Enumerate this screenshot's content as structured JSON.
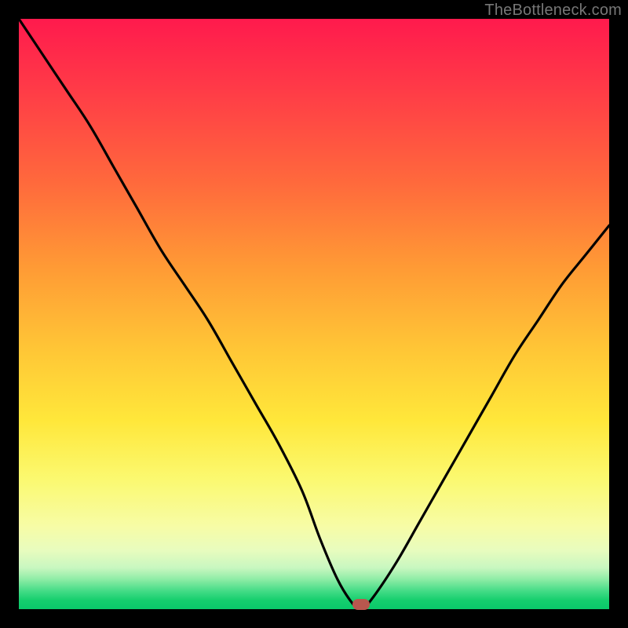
{
  "attribution": "TheBottleneck.com",
  "chart_data": {
    "type": "line",
    "title": "",
    "xlabel": "",
    "ylabel": "",
    "xlim": [
      0,
      100
    ],
    "ylim": [
      0,
      100
    ],
    "series": [
      {
        "name": "bottleneck-curve",
        "x": [
          0,
          4,
          8,
          12,
          16,
          20,
          24,
          28,
          32,
          36,
          40,
          44,
          48,
          51,
          54,
          56.5,
          58,
          60,
          64,
          68,
          72,
          76,
          80,
          84,
          88,
          92,
          96,
          100
        ],
        "y": [
          100,
          94,
          88,
          82,
          75,
          68,
          61,
          55,
          49,
          42,
          35,
          28,
          20,
          12,
          5,
          1,
          0,
          2,
          8,
          15,
          22,
          29,
          36,
          43,
          49,
          55,
          60,
          65
        ]
      }
    ],
    "marker": {
      "x": 58,
      "y": 0.8,
      "label": "optimal-point"
    },
    "colors": {
      "curve": "#000000",
      "marker": "#b9574e",
      "gradient_top": "#ff1a4d",
      "gradient_bottom": "#0ac96a",
      "frame": "#000000"
    }
  }
}
